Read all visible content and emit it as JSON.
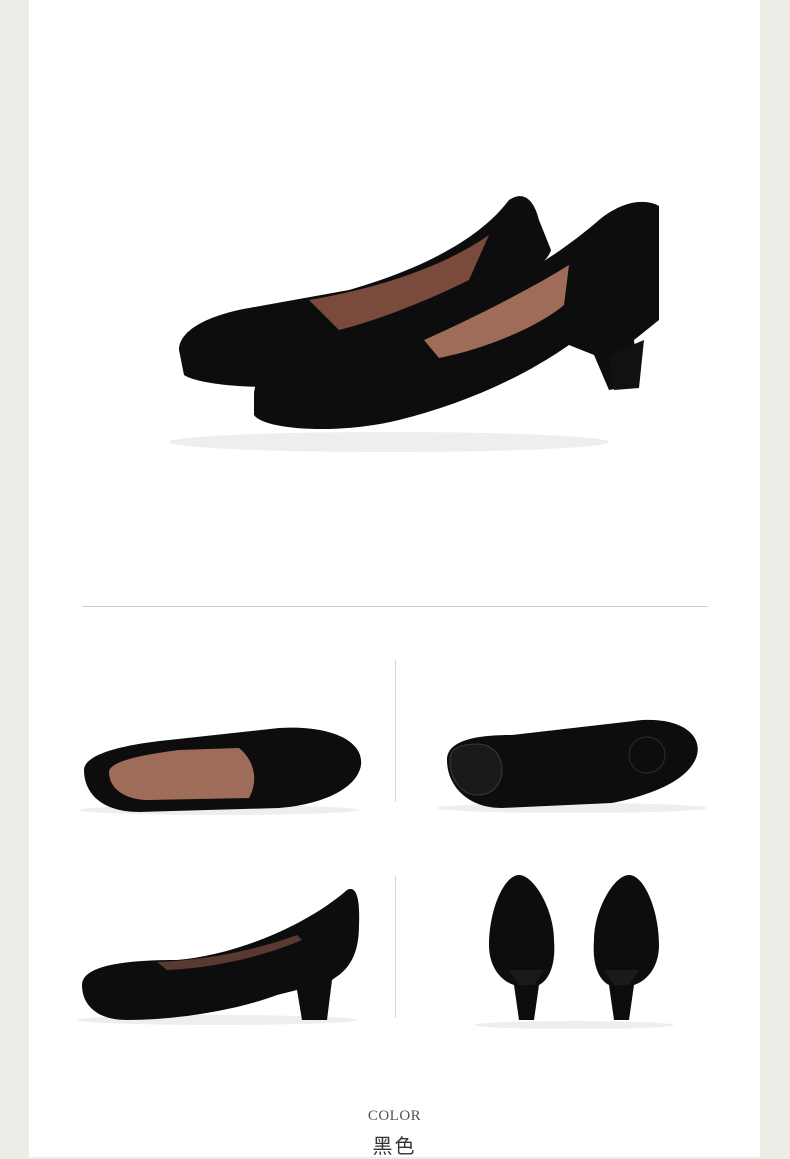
{
  "product": {
    "color_label": "COLOR",
    "color_value": "黑色"
  },
  "icons": {
    "hero": "black-suede-pumps-pair-image",
    "inside": "shoe-top-inside-view-image",
    "sole": "shoe-sole-view-image",
    "side": "shoe-side-view-image",
    "back": "shoe-back-view-image"
  },
  "colors": {
    "background": "#ecede6",
    "panel": "#ffffff",
    "shoe": "#0d0d0d",
    "lining": "#a06c5a",
    "divider": "#cfcfcf"
  }
}
